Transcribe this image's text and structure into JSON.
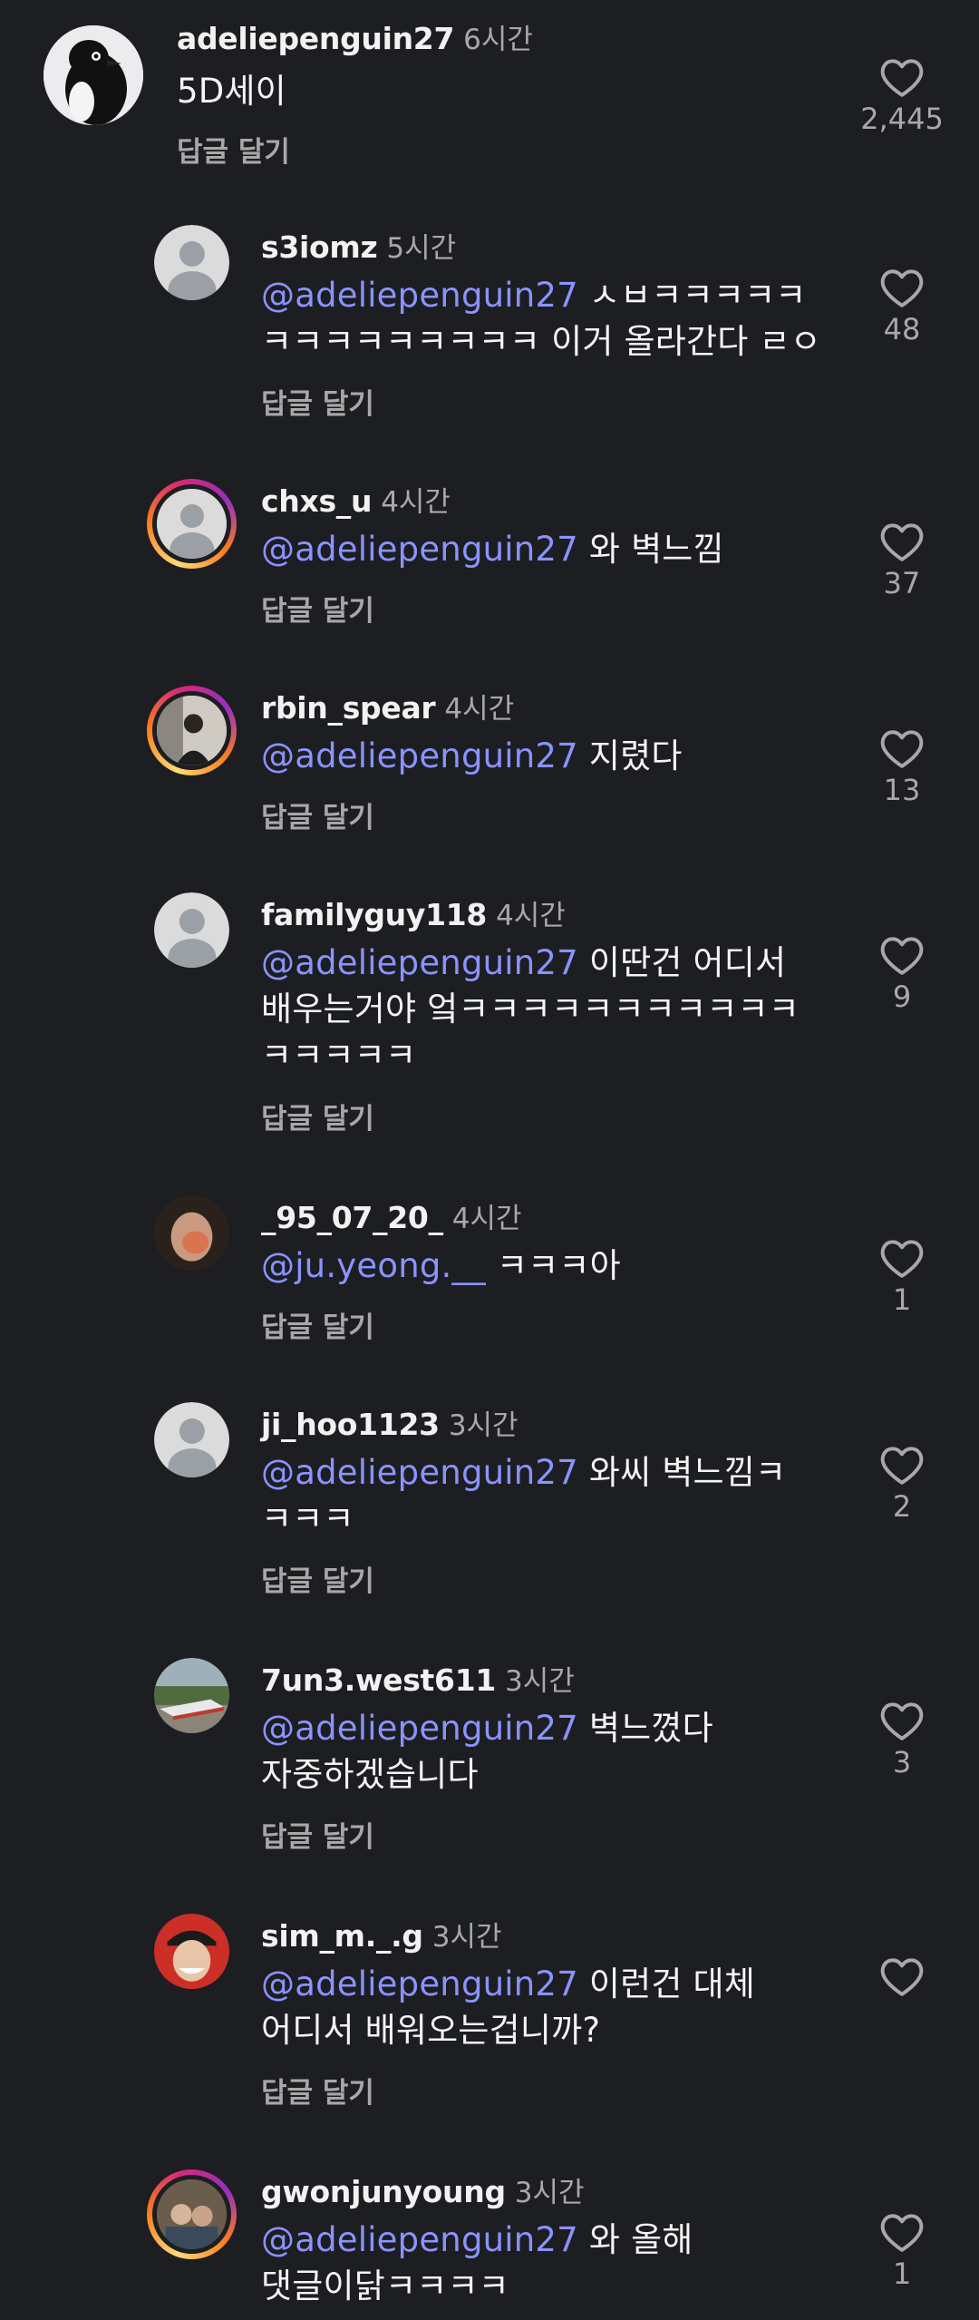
{
  "top_comment": {
    "username": "adeliepenguin27",
    "time": "6시간",
    "text": "5D세이",
    "reply_label": "답글 달기",
    "likes": "2,445"
  },
  "replies": [
    {
      "username": "s3iomz",
      "time": "5시간",
      "mention": "@adeliepenguin27",
      "text_line1": " ㅅㅂㅋㅋㅋㅋㅋ",
      "text_line2": "ㅋㅋㅋㅋㅋㅋㅋㅋㅋ 이거 올라간다 ㄹㅇ",
      "reply_label": "답글 달기",
      "likes": "48"
    },
    {
      "username": "chxs_u",
      "time": "4시간",
      "mention": "@adeliepenguin27",
      "text_line1": " 와 벽느낌",
      "reply_label": "답글 달기",
      "likes": "37"
    },
    {
      "username": "rbin_spear",
      "time": "4시간",
      "mention": "@adeliepenguin27",
      "text_line1": " 지렸다",
      "reply_label": "답글 달기",
      "likes": "13"
    },
    {
      "username": "familyguy118",
      "time": "4시간",
      "mention": "@adeliepenguin27",
      "text_line1": " 이딴건 어디서",
      "text_line2": "배우는거야 엌ㅋㅋㅋㅋㅋㅋㅋㅋㅋㅋㅋ",
      "text_line3": "ㅋㅋㅋㅋㅋ",
      "reply_label": "답글 달기",
      "likes": "9"
    },
    {
      "username": "_95_07_20_",
      "time": "4시간",
      "mention": "@ju.yeong.__",
      "text_line1": " ㅋㅋㅋ아",
      "reply_label": "답글 달기",
      "likes": "1"
    },
    {
      "username": "ji_hoo1123",
      "time": "3시간",
      "mention": "@adeliepenguin27",
      "text_line1": " 와씨 벽느낌ㅋ",
      "text_line2": "ㅋㅋㅋ",
      "reply_label": "답글 달기",
      "likes": "2"
    },
    {
      "username": "7un3.west611",
      "time": "3시간",
      "mention": "@adeliepenguin27",
      "text_line1": " 벽느꼈다",
      "text_line2": "자중하겠습니다",
      "reply_label": "답글 달기",
      "likes": "3"
    },
    {
      "username": "sim_m._.g",
      "time": "3시간",
      "mention": "@adeliepenguin27",
      "text_line1": " 이런건 대체",
      "text_line2": "어디서 배워오는겁니까?",
      "reply_label": "답글 달기",
      "likes": ""
    },
    {
      "username": "gwonjunyoung",
      "time": "3시간",
      "mention": "@adeliepenguin27",
      "text_line1": " 와 올해",
      "text_line2": "댓글이닭ㅋㅋㅋㅋ",
      "likes": "1"
    }
  ],
  "colors": {
    "background": "#1c1e21",
    "mention": "#8a93ff",
    "secondary_text": "#a8a8a8",
    "story_ring": "#d62976"
  }
}
